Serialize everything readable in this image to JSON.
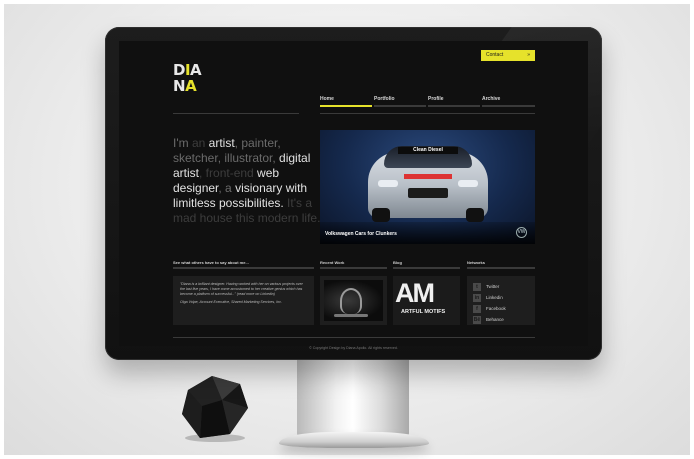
{
  "contact": {
    "label": "Contact",
    "arrow": "»"
  },
  "logo": {
    "line1_a": "D",
    "line1_b": "I",
    "line1_c": "A",
    "line2_a": "N",
    "line2_b": "A"
  },
  "nav": [
    {
      "label": "Home",
      "active": true
    },
    {
      "label": "Portfolio",
      "active": false
    },
    {
      "label": "Profile",
      "active": false
    },
    {
      "label": "Archive",
      "active": false
    }
  ],
  "tagline": {
    "p1": "I'm ",
    "p2": "an ",
    "p3": "artist",
    "p4": ", painter, sketcher, illustrator, ",
    "p5": "digital artist",
    "p6": ", front-end ",
    "p7": "web designer",
    "p8": ", a ",
    "p9": "visionary with limitless possibilities.",
    "p10": " It's a mad house this modern life."
  },
  "hero": {
    "banner": "Clean Diesel",
    "caption": "Volkswagen Cars for Clunkers",
    "badge": "VW"
  },
  "sections": {
    "testimonial_title": "See what others have to say about me...",
    "recent_title": "Recent Work",
    "blog_title": "Blog",
    "networks_title": "Networks"
  },
  "testimonial": {
    "text": "\"Diana is a brilliant designer. Having worked with her on various projects over the last five years, I have come accustomed to her creative genius which has become a platform of successful...\" (read more on Linkedin)",
    "author": "Olga Volpe, Account Executive, Shared Marketing Services, Inc."
  },
  "blog": {
    "mark": "AM",
    "label": "ARTFUL MOTIFS"
  },
  "networks": [
    {
      "label": "Twitter",
      "glyph": "t"
    },
    {
      "label": "Linkedin",
      "glyph": "in"
    },
    {
      "label": "Facebook",
      "glyph": "f"
    },
    {
      "label": "Behance",
      "glyph": "Bē"
    }
  ],
  "footer": "© Copyright Design by Diana Apollo. All rights reserved.",
  "colors": {
    "accent": "#e6e22b",
    "screen_bg": "#101010",
    "panel_bg": "#1e1e1e"
  }
}
